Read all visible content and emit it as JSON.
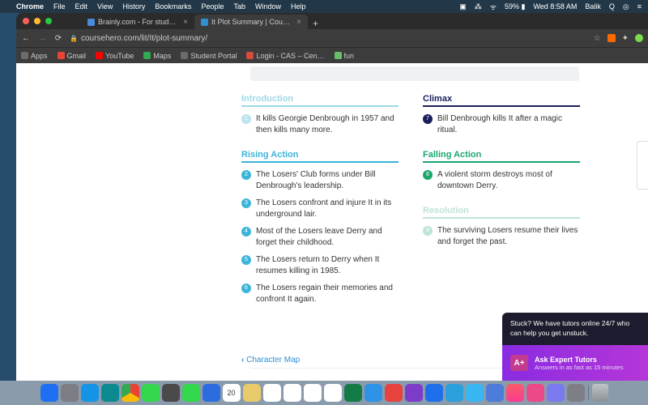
{
  "menubar": {
    "app": "Chrome",
    "items": [
      "File",
      "Edit",
      "View",
      "History",
      "Bookmarks",
      "People",
      "Tab",
      "Window",
      "Help"
    ],
    "right": {
      "battery": "59%",
      "wifi": "●",
      "time": "Wed 8:58 AM",
      "user": "Balik"
    }
  },
  "browser": {
    "tabs": [
      {
        "label": "Brainly.com - For students. By",
        "active": false,
        "favicon": "#4b8bdc"
      },
      {
        "label": "It Plot Summary | Course Hero",
        "active": true,
        "favicon": "#2e90d1"
      }
    ],
    "url": "coursehero.com/lit/It/plot-summary/",
    "bookmarks": [
      {
        "label": "Apps",
        "color": "#6b6b6b"
      },
      {
        "label": "Gmail",
        "color": "#ea4335"
      },
      {
        "label": "YouTube",
        "color": "#ff0000"
      },
      {
        "label": "Maps",
        "color": "#34a853"
      },
      {
        "label": "Student Portal",
        "color": "#6b6b6b"
      },
      {
        "label": "Login - CAS – Cen…",
        "color": "#d94b3a"
      },
      {
        "label": "fun",
        "color": "#6bbf6b"
      }
    ]
  },
  "plot": {
    "introduction": {
      "title": "Introduction",
      "items": [
        {
          "n": "1",
          "text": "It kills Georgie Denbrough in 1957 and then kills many more."
        }
      ]
    },
    "rising": {
      "title": "Rising Action",
      "items": [
        {
          "n": "2",
          "text": "The Losers' Club forms under Bill Denbrough's leadership."
        },
        {
          "n": "3",
          "text": "The Losers confront and injure It in its underground lair."
        },
        {
          "n": "4",
          "text": "Most of the Losers leave Derry and forget their childhood."
        },
        {
          "n": "5",
          "text": "The Losers return to Derry when It resumes killing in 1985."
        },
        {
          "n": "6",
          "text": "The Losers regain their memories and confront It again."
        }
      ]
    },
    "climax": {
      "title": "Climax",
      "items": [
        {
          "n": "7",
          "text": "Bill Denbrough kills It after a magic ritual."
        }
      ]
    },
    "falling": {
      "title": "Falling Action",
      "items": [
        {
          "n": "8",
          "text": "A violent storm destroys most of downtown Derry."
        }
      ]
    },
    "resolution": {
      "title": "Resolution",
      "items": [
        {
          "n": "9",
          "text": "The surviving Losers resume their lives and forget the past."
        }
      ]
    }
  },
  "nav": {
    "prev": "Character Map"
  },
  "helpbox": "Stuck? We have tutors online 24/7 who can help you get unstuck.",
  "cta": {
    "badge": "A+",
    "title": "Ask Expert Tutors",
    "sub": "Answers in as fast as 15 minutes"
  },
  "dock_colors": [
    "#1e6ff2",
    "#7d7d85",
    "#1593e6",
    "#0b8a8f",
    "#fff",
    "#32d74b",
    "#4a4a4a",
    "#32d74b",
    "#2d6cdf",
    "#fff",
    "#e8ca6b",
    "#fff",
    "#fff",
    "#fff",
    "#fff",
    "#147b45",
    "#2e93e6",
    "#e8423f",
    "#7d3cc8",
    "#1f6feb",
    "#2aa1dd",
    "#38b6f1",
    "#4c7bd9",
    "#fff",
    "#ff3b30",
    "#ec4989",
    "#7a7aee",
    "#7e7e86"
  ]
}
